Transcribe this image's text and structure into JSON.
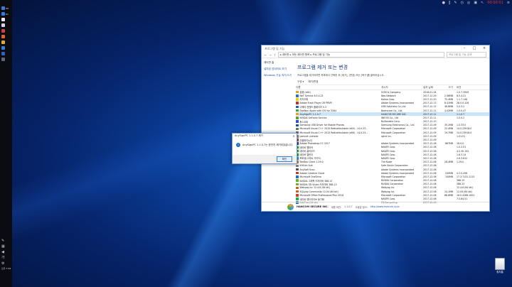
{
  "colors": {
    "accent": "#1e6fd0",
    "selection": "#cce4f7",
    "link": "#1a4fa0"
  },
  "taskbar": {
    "items": [
      {
        "label": "HE",
        "icon": "app-icon",
        "color": "#3a7bd5"
      },
      {
        "label": "Do",
        "icon": "document-icon",
        "color": "#2b7de9"
      },
      {
        "label": "",
        "icon": "app-icon",
        "color": "#e8eaf0"
      },
      {
        "label": "",
        "icon": "app-icon",
        "color": "#cfd8e6"
      },
      {
        "label": "",
        "icon": "app-icon",
        "color": "#d04040"
      },
      {
        "label": "",
        "icon": "app-icon",
        "color": "#e06030"
      },
      {
        "label": "",
        "icon": "app-icon",
        "color": "#e0b020"
      },
      {
        "label": "",
        "icon": "app-icon",
        "color": "#3080e0"
      },
      {
        "label": "",
        "icon": "app-icon",
        "color": "#3060c0"
      },
      {
        "label": "",
        "icon": "app-icon",
        "color": "#606878"
      }
    ],
    "clock": "오후 7:58"
  },
  "topbar": {
    "rec": "00:00:01"
  },
  "desktop": {
    "recycle_bin": "휴지통"
  },
  "window": {
    "title": "프로그램 및 기능",
    "address": "▸ 제어판 ▸ 모든 제어판 항목 ▸ 프로그램 및 기능",
    "search_placeholder": "프로그램 및 기능 검색",
    "sidebar": {
      "home": "제어판 홈",
      "links": [
        "설치된 업데이트 보기",
        "Windows 기능 켜기/끄기"
      ]
    },
    "heading": "프로그램 제거 또는 변경",
    "description": "프로그램을 제거하려면 목록에서 선택한 후 [제거], [변경] 또는 [복구]를 클릭하십시오.",
    "commands": [
      "구성 ▾",
      "제거/변경"
    ],
    "columns": [
      "이름",
      "게시자",
      "설치 날짜",
      "크기",
      "버전"
    ],
    "rows": [
      {
        "name": "곰캠 (x64)",
        "publisher": "GOM & Company",
        "date": "2018-01-04",
        "size": "",
        "version": "1.0.7.3509",
        "color": "#e0a020"
      },
      {
        "name": "NeT Service 8.5.4.21",
        "publisher": "Neo Network",
        "date": "2017-12-29",
        "size": "2.98MB",
        "version": "8.5.4.21",
        "color": "#3070c0"
      },
      {
        "name": "카카오톡",
        "publisher": "Kakao Corp.",
        "date": "2017-12-20",
        "size": "75.4MB",
        "version": "1.1.7.148",
        "color": "#f0d000"
      },
      {
        "name": "Adobe Flash Player 28 PPAPI",
        "publisher": "Adobe Systems Incorporated",
        "date": "2017-12-13",
        "size": "8.41MB",
        "version": "28.0.0.126",
        "color": "#c03030"
      },
      {
        "name": "디렉터 컨텐츠 플레이어 5.3",
        "publisher": "USB Solutions Co.,Ltd",
        "date": "2017-12-12",
        "size": "46.8MB",
        "version": "5.0.3.2",
        "color": "#2060b0"
      },
      {
        "name": "DaeNon Apple with iOS for 3264",
        "publisher": "Badrscore Co., Ltd.",
        "date": "2017-12-11",
        "size": "4.02MB",
        "version": "1.0.0.47",
        "color": "#40a040"
      },
      {
        "name": "AnySignPC 1.1.0.7",
        "publisher": "HANCOM SECURE INC.",
        "date": "2017-12-11",
        "size": "",
        "version": "1.1.0.7",
        "color": "#f0a020",
        "selected": true
      },
      {
        "name": "NVIDIA GeForce Service",
        "publisher": "INEOSI Co., Ltd",
        "date": "2017-12-11",
        "size": "",
        "version": "1.0.0.2",
        "color": "#60a030"
      },
      {
        "name": "토스오피",
        "publisher": "Builtmedia Corp.",
        "date": "2017-12-10",
        "size": "",
        "version": "",
        "color": "#3050c0"
      },
      {
        "name": "Samsung USB Driver for Mobile Phones",
        "publisher": "Samsung Electronics Co., Ltd.",
        "date": "2017-12-09",
        "size": "35.2MB",
        "version": "1.5.33.0",
        "color": "#1a4fa0"
      },
      {
        "name": "Microsoft Visual C++ 2015 Redistributable (x64) - 14.0.23...",
        "publisher": "Microsoft Corporation",
        "date": "2017-12-09",
        "size": "22.4MB",
        "version": "14.0.23918.0",
        "color": "#707070"
      },
      {
        "name": "Microsoft Visual C++ 2015 Redistributable (x86) - 14.0.23...",
        "publisher": "Microsoft Corporation",
        "date": "2017-12-09",
        "size": "19.7MB",
        "version": "14.0.23918.0",
        "color": "#707070"
      },
      {
        "name": "camnet unihead",
        "publisher": "rghld Inc.",
        "date": "2017-12-09",
        "size": "",
        "version": "1.01.01",
        "color": "#909090"
      },
      {
        "name": "주물파이노다",
        "publisher": "",
        "date": "2017-12-09",
        "size": "",
        "version": "",
        "color": "#c04040"
      },
      {
        "name": "Adobe Photoshop CC 2017",
        "publisher": "Adobe Systems Incorporated",
        "date": "2017-12-06",
        "size": "867MB",
        "version": "18.0.0",
        "color": "#1f4f90"
      },
      {
        "name": "네이버 웹마커",
        "publisher": "NAVER Corp.",
        "date": "2017-12-06",
        "size": "",
        "version": "1.0.2.51",
        "color": "#20b040"
      },
      {
        "name": "네이버 클라우드",
        "publisher": "NAVER Corp.",
        "date": "2017-12-06",
        "size": "",
        "version": "4.0.30.102",
        "color": "#20b040"
      },
      {
        "name": "네이버 캘린더",
        "publisher": "NAVER Corp.",
        "date": "2017-12-06",
        "size": "",
        "version": "1.8.3.14",
        "color": "#20b040"
      },
      {
        "name": "포토뷰(스마트 가이드)",
        "publisher": "NAVER Corp.",
        "date": "2017-12-06",
        "size": "",
        "version": "2.6.3.612",
        "color": "#3090e0"
      },
      {
        "name": "TeeDou Client 1.29.0",
        "publisher": "Tim Koser",
        "date": "2017-12-06",
        "size": "28.4MB",
        "version": "1.29.0",
        "color": "#e08020"
      },
      {
        "name": "KHGdn Suit",
        "publisher": "Safe Soluin Corporation",
        "date": "2017-12-06",
        "size": "",
        "version": "",
        "color": "#808080"
      },
      {
        "name": "AnySoft Scan",
        "publisher": "Adobe Systems Incorporated",
        "date": "2017-12-06",
        "size": "",
        "version": "",
        "color": "#505050"
      },
      {
        "name": "Adobe Creative Cloud",
        "publisher": "Adobe Systems Incorporated",
        "date": "2017-12-06",
        "size": "240MB",
        "version": "4.3.0.256",
        "color": "#d03030"
      },
      {
        "name": "Microsoft OneDrive",
        "publisher": "Microsoft Corporation",
        "date": "2017-12-06",
        "size": "100MB",
        "version": "17.3.7131.1115",
        "color": "#2070d0"
      },
      {
        "name": "NVIDIA 그래픽 드라이버 388.13",
        "publisher": "NVIDIA Corporation",
        "date": "2017-12-06",
        "size": "",
        "version": "388.13",
        "color": "#70b020"
      },
      {
        "name": "NVIDIA 3D Vision 드라이버 388.13",
        "publisher": "NVIDIA Corporation",
        "date": "2017-12-06",
        "size": "",
        "version": "388.13",
        "color": "#70b020"
      },
      {
        "name": "Webyog Inc 12.4.8 (64 bit)",
        "publisher": "Webyog Inc",
        "date": "2017-12-06",
        "size": "",
        "version": "12.4.8 (64 bit)",
        "color": "#d06020"
      },
      {
        "name": "SQLyog Community 12.04 (64 bit)",
        "publisher": "Webyog Inc",
        "date": "2017-12-06",
        "size": "14.1MB",
        "version": "12.04 (64 bit)",
        "color": "#d06020"
      },
      {
        "name": "Microsoft Office Professional Plus 2016",
        "publisher": "Microsoft Corporation",
        "date": "2017-12-06",
        "size": "86.8MB",
        "version": "16.0.4266.1001",
        "color": "#d04020"
      },
      {
        "name": "네이버 엔드라이브 동기화",
        "publisher": "NAVER Corp.",
        "date": "2017-12-06",
        "size": "",
        "version": "7.0.64.51",
        "color": "#20b040"
      },
      {
        "name": "EditPlus (64 bit)",
        "publisher": "ES-Computing",
        "date": "2017-12-06",
        "size": "",
        "version": "",
        "color": "#3070c0"
      }
    ],
    "details": {
      "name": "HANCOM SECURE INC.",
      "version_label": "제품 버전:",
      "version": "1.1.0.7",
      "support_label": "도움말 링크:",
      "support": "http://www.hsecure.co.kr"
    }
  },
  "dialog": {
    "title": "AnySignPC 1.1.0.7 제거",
    "message": "AnySignPC 1.1.0.7는 완전히 제거되었습니다.",
    "ok": "확인"
  }
}
